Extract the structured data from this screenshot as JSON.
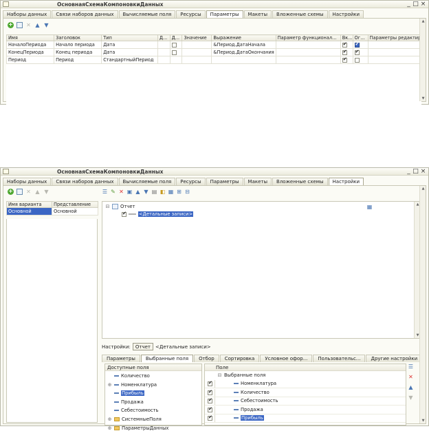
{
  "colors": {
    "selection": "#3b66c4",
    "tab_bg": "#e6e5d6",
    "add_icon": "#4fa832",
    "delete_icon": "#dd3333"
  },
  "window1": {
    "title": "ОсновнаяСхемаКомпоновкиДанных",
    "tabs": [
      "Наборы данных",
      "Связи наборов данных",
      "Вычисляемые поля",
      "Ресурсы",
      "Параметры",
      "Макеты",
      "Вложенные схемы",
      "Настройки"
    ],
    "active_tab": 4,
    "toolbar_icons": [
      "add-icon",
      "copy-icon",
      "delete-icon",
      "move-up-icon",
      "move-down-icon"
    ],
    "table": {
      "columns": [
        "Имя",
        "Заголовок",
        "Тип",
        "Д...",
        "Д...",
        "Значение",
        "Выражение",
        "Параметр функционал...",
        "Вк...",
        "Ог...",
        "Параметры редактиро..."
      ],
      "rows": [
        {
          "name": "НачалоПериода",
          "title": "Начало периода",
          "type": "Дата",
          "d1": "",
          "d2": false,
          "value": "",
          "expression": "&Период.ДатаНачала",
          "param": "",
          "vk": true,
          "og": true,
          "edit": ""
        },
        {
          "name": "КонецПериода",
          "title": "Конец периода",
          "type": "Дата",
          "d1": "",
          "d2": false,
          "value": "",
          "expression": "&Период.ДатаОкончания",
          "param": "",
          "vk": true,
          "og": true,
          "edit": ""
        },
        {
          "name": "Период",
          "title": "Период",
          "type": "СтандартныйПериод",
          "d1": "",
          "d2": null,
          "value": "",
          "expression": "",
          "param": "",
          "vk": true,
          "og": false,
          "edit": ""
        }
      ]
    }
  },
  "window2": {
    "title": "ОсновнаяСхемаКомпоновкиДанных",
    "tabs": [
      "Наборы данных",
      "Связи наборов данных",
      "Вычисляемые поля",
      "Ресурсы",
      "Параметры",
      "Макеты",
      "Вложенные схемы",
      "Настройки"
    ],
    "active_tab": 7,
    "variants": {
      "columns": [
        "Имя варианта",
        "Представление"
      ],
      "rows": [
        [
          "Основной",
          "Основной"
        ]
      ]
    },
    "structure": {
      "root": "Отчет",
      "child": "<Детальные записи>"
    },
    "settings_bar": {
      "label": "Настройки:",
      "report_button": "Отчет",
      "current": "<Детальные записи>"
    },
    "sub_tabs": [
      "Параметры",
      "Выбранные поля",
      "Отбор",
      "Сортировка",
      "Условное офор...",
      "Пользовательс...",
      "Другие настройки"
    ],
    "active_sub_tab": 1,
    "available_fields": {
      "header": "Доступные поля",
      "items": [
        {
          "label": "Количество",
          "kind": "field",
          "expand": ""
        },
        {
          "label": "Номенклатура",
          "kind": "field",
          "expand": "⊕"
        },
        {
          "label": "Прибыль",
          "kind": "field",
          "expand": "",
          "selected": true
        },
        {
          "label": "Продажа",
          "kind": "field",
          "expand": ""
        },
        {
          "label": "Себестоимость",
          "kind": "field",
          "expand": ""
        },
        {
          "label": "СистемныеПоля",
          "kind": "folder",
          "expand": "⊕"
        },
        {
          "label": "ПараметрыДанных",
          "kind": "folder",
          "expand": "⊕"
        }
      ]
    },
    "selected_fields": {
      "header": "Поле",
      "root": "Выбранные поля",
      "items": [
        {
          "label": "Номенклатура",
          "checked": true
        },
        {
          "label": "Количество",
          "checked": true
        },
        {
          "label": "Себестоимость",
          "checked": true
        },
        {
          "label": "Продажа",
          "checked": true
        },
        {
          "label": "Прибыль",
          "checked": true,
          "selected": true
        }
      ]
    }
  }
}
